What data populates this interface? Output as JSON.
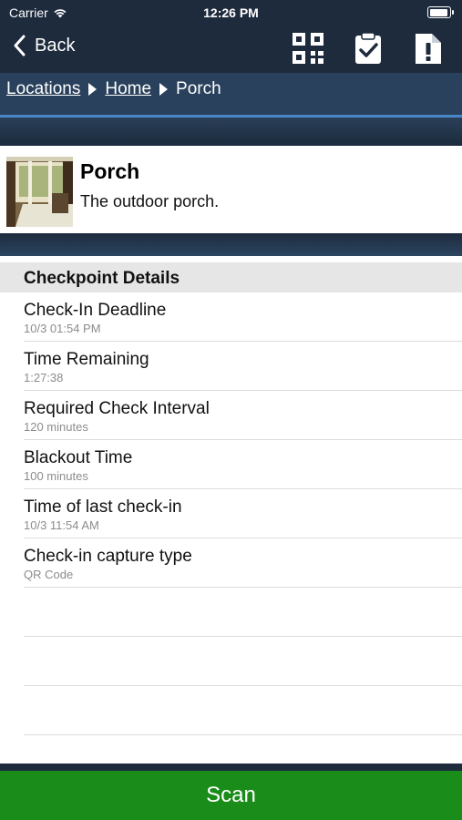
{
  "status_bar": {
    "carrier": "Carrier",
    "time": "12:26 PM"
  },
  "nav": {
    "back_label": "Back"
  },
  "breadcrumb": [
    "Locations",
    "Home",
    "Porch"
  ],
  "location": {
    "title": "Porch",
    "description": "The outdoor porch."
  },
  "details": {
    "header": "Checkpoint Details",
    "rows": [
      {
        "title": "Check-In Deadline",
        "value": "10/3 01:54 PM"
      },
      {
        "title": "Time Remaining",
        "value": "1:27:38"
      },
      {
        "title": "Required Check Interval",
        "value": "120 minutes"
      },
      {
        "title": "Blackout Time",
        "value": "100 minutes"
      },
      {
        "title": "Time of last check-in",
        "value": "10/3 11:54 AM"
      },
      {
        "title": "Check-in capture type",
        "value": "QR Code"
      }
    ]
  },
  "scan_button": "Scan",
  "colors": {
    "nav_bg": "#1d2b3d",
    "breadcrumb_bg": "#29415c",
    "accent_line": "#4786c9",
    "scan_bg": "#1a8c1a"
  },
  "icons": [
    "wifi-icon",
    "battery-icon",
    "back-chevron-icon",
    "qr-code-icon",
    "clipboard-check-icon",
    "document-alert-icon"
  ]
}
